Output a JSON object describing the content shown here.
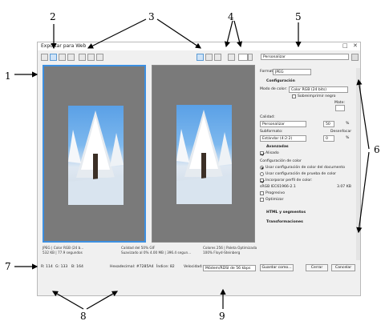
{
  "annotations": {
    "n1": "1",
    "n2": "2",
    "n3": "3",
    "n4": "4",
    "n5": "5",
    "n6": "6",
    "n7": "7",
    "n8": "8",
    "n9": "9"
  },
  "window": {
    "title": "Exportar para Web",
    "restore_icon": "□",
    "close_icon": "✕"
  },
  "toolbar": {
    "color_label": "",
    "preset": "Personalizar"
  },
  "preview_left": {
    "line1": "JPEG | Color RGB (24 b...",
    "line2": "532 KB | 77.9 segundos",
    "line3": "Calidad del 50%  GIF",
    "line4": "Suavizado al 0%  4.00 MB | 396.4 segun..."
  },
  "preview_right": {
    "line1": "Colores 256 | Paleta Optimizada",
    "line2": "100% Floyd-Steinberg"
  },
  "status": {
    "rgb_r": "R: 114",
    "rgb_g": "G: 133",
    "rgb_b": "B: 164",
    "hex": "Hexadecimal: #7285A4",
    "index": "Índice: 82",
    "speed_label": "Velocidad:",
    "speed_value": "Módem/RDSI de 56 kbps",
    "save_as": "Guardar como...",
    "close": "Cerrar",
    "cancel": "Cancelar"
  },
  "sidebar": {
    "format_label": "Formato:",
    "format_value": "JPEG",
    "config_header": "Configuración",
    "color_mode_label": "Modo de color:",
    "color_mode_value": "Color RGB (24 bits)",
    "overprint_black": "Sobreimprimir negro",
    "mate_label": "Mate:",
    "quality_label": "Calidad:",
    "quality_mode": "Personalizar",
    "quality_value": "50",
    "percent": "%",
    "subformat_label": "Subformato:",
    "blur_label": "Desenfocar",
    "subformat_value": "Estándar (4:2:2)",
    "blur_value": "0",
    "advanced_header": "Avanzadas",
    "smoothed": "Alisado",
    "color_config_label": "Configuración de color",
    "opt_doc": "Usar configuración de color del documento",
    "opt_proof": "Usar configuración de prueba de color",
    "embed_profile": "Incorporar perfil de color:",
    "profile_name": "sRGB IEC61966-2.1",
    "profile_size": "3.07 KB",
    "progressive": "Progresivo",
    "optimize": "Optimizar",
    "html_header": "HTML y segmentos",
    "transform_header": "Transformaciones"
  }
}
